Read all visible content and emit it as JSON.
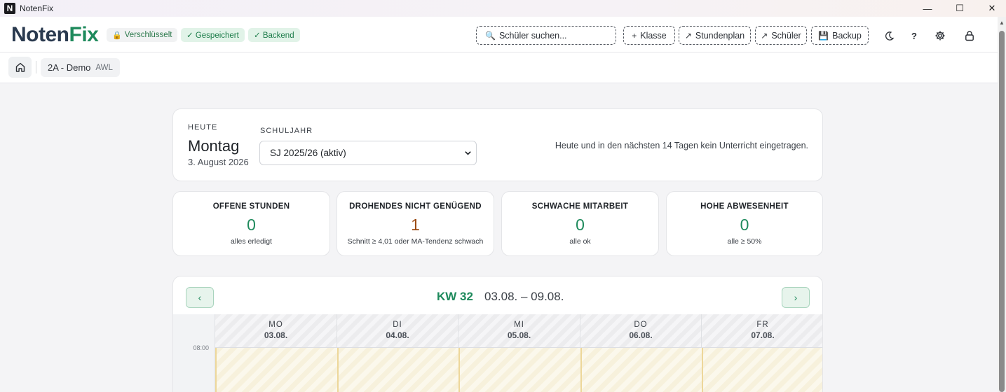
{
  "window": {
    "title": "NotenFix",
    "logo_letter": "N",
    "minimize": "—",
    "maximize": "☐",
    "close": "✕"
  },
  "header": {
    "brand_part1": "Noten",
    "brand_part2": "Fix",
    "badges": {
      "encrypted": "Verschlüsselt",
      "saved": "✓ Gespeichert",
      "backend": "✓ Backend"
    },
    "search_placeholder": "Schüler suchen...",
    "buttons": {
      "klasse": "Klasse",
      "stundenplan": "Stundenplan",
      "schueler": "Schüler",
      "backup": "Backup",
      "help": "?"
    },
    "icons": [
      "lock-icon",
      "search-icon",
      "plus-icon",
      "arrow-icon",
      "backup-icon",
      "moon-icon",
      "help-icon",
      "gear-icon",
      "unlock-icon"
    ]
  },
  "breadcrumb": {
    "class_name": "2A - Demo",
    "subject": "AWL"
  },
  "today": {
    "label": "HEUTE",
    "weekday": "Montag",
    "date": "3. August 2026",
    "schoolyear_label": "SCHULJAHR",
    "schoolyear_value": "SJ 2025/26 (aktiv)",
    "message": "Heute und in den nächsten 14 Tagen kein Unterricht eingetragen."
  },
  "stats": [
    {
      "title": "OFFENE STUNDEN",
      "value": "0",
      "sub": "alles erledigt"
    },
    {
      "title": "DROHENDES NICHT GENÜGEND",
      "value": "1",
      "sub": "Schnitt ≥ 4,01 oder MA-Tendenz schwach"
    },
    {
      "title": "SCHWACHE MITARBEIT",
      "value": "0",
      "sub": "alle ok"
    },
    {
      "title": "HOHE ABWESENHEIT",
      "value": "0",
      "sub": "alle ≥ 50%"
    }
  ],
  "week": {
    "kw": "KW 32",
    "range": "03.08. – 09.08.",
    "prev": "‹",
    "next": "›",
    "time_first": "08:00",
    "days": [
      {
        "name": "MO",
        "date": "03.08."
      },
      {
        "name": "DI",
        "date": "04.08."
      },
      {
        "name": "MI",
        "date": "05.08."
      },
      {
        "name": "DO",
        "date": "06.08."
      },
      {
        "name": "FR",
        "date": "07.08."
      }
    ]
  },
  "colors": {
    "accent": "#1e8a5c",
    "brand_dark": "#2a3a4f",
    "warn": "#9a4a12"
  }
}
